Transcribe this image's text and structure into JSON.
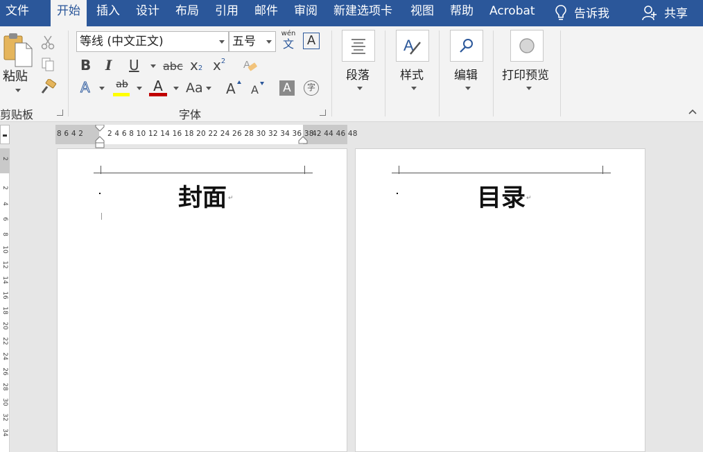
{
  "menubar": {
    "tabs": [
      "文件",
      "开始",
      "插入",
      "设计",
      "布局",
      "引用",
      "邮件",
      "审阅",
      "新建选项卡",
      "视图",
      "帮助",
      "Acrobat"
    ],
    "active_tab": "开始",
    "tell_me": "告诉我",
    "share": "共享"
  },
  "ribbon": {
    "clipboard": {
      "paste_label": "粘贴",
      "group_label": "剪贴板"
    },
    "font": {
      "font_name": "等线 (中文正文)",
      "font_size": "五号",
      "phonetic_top": "wén",
      "phonetic_bottom": "文",
      "border_char": "A",
      "bold": "B",
      "italic": "I",
      "underline": "U",
      "strike": "abc",
      "subscript": "x",
      "subscript_mark": "2",
      "superscript": "x",
      "superscript_mark": "2",
      "text_effect": "A",
      "highlight_text": "ab",
      "font_color_char": "A",
      "change_case": "Aa",
      "grow_font": "A",
      "shrink_font": "A",
      "char_shading": "A",
      "enclose_char": "字",
      "group_label": "字体",
      "highlight_color": "#ffff00",
      "font_color": "#c00000"
    },
    "paragraph": {
      "label": "段落"
    },
    "styles": {
      "label": "样式"
    },
    "editing": {
      "label": "编辑"
    },
    "print_preview": {
      "label": "打印预览"
    }
  },
  "ruler": {
    "left_numbers": "8 6 4 2",
    "mid_numbers": "2 4 6 8 10 12 14 16 18 20 22 24 26 28 30 32 34 36 38",
    "right_numbers": "42 44 46 48",
    "vertical_numbers": [
      "2",
      "2",
      "4",
      "6",
      "8",
      "10",
      "12",
      "14",
      "16",
      "18",
      "20",
      "22",
      "24",
      "26",
      "28",
      "30",
      "32",
      "34"
    ]
  },
  "pages": [
    {
      "title": "封面",
      "para_mark": "↵"
    },
    {
      "title": "目录",
      "para_mark": "↵"
    }
  ],
  "colors": {
    "accent": "#2b579a",
    "ribbon_bg": "#f3f3f3",
    "workspace": "#e6e6e6"
  }
}
